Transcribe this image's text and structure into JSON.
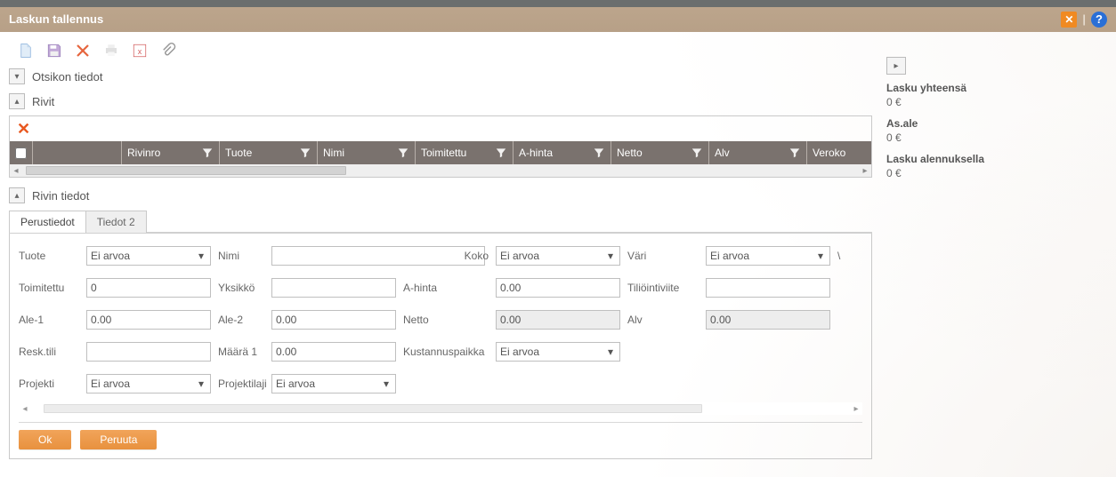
{
  "header": {
    "title": "Laskun tallennus"
  },
  "sections": {
    "otsikko": "Otsikon tiedot",
    "rivit": "Rivit",
    "rivin_tiedot": "Rivin tiedot"
  },
  "grid": {
    "columns": [
      "Rivinro",
      "Tuote",
      "Nimi",
      "Toimitettu",
      "A-hinta",
      "Netto",
      "Alv",
      "Veroko"
    ]
  },
  "tabs": {
    "perustiedot": "Perustiedot",
    "tiedot2": "Tiedot 2"
  },
  "form": {
    "labels": {
      "tuote": "Tuote",
      "nimi": "Nimi",
      "koko": "Koko",
      "vari": "Väri",
      "toimitettu": "Toimitettu",
      "yksikko": "Yksikkö",
      "ahinta": "A-hinta",
      "tilioiviite": "Tiliöintiviite",
      "ale1": "Ale-1",
      "ale2": "Ale-2",
      "netto": "Netto",
      "alv": "Alv",
      "resktili": "Resk.tili",
      "maara1": "Määrä 1",
      "kustannuspaikka": "Kustannuspaikka",
      "projekti": "Projekti",
      "projektilaji": "Projektilaji"
    },
    "values": {
      "tuote": "Ei arvoa",
      "nimi": "",
      "koko": "Ei arvoa",
      "vari": "Ei arvoa",
      "toimitettu": "0",
      "yksikko": "",
      "ahinta": "0.00",
      "tilioiviite": "",
      "ale1": "0.00",
      "ale2": "0.00",
      "netto": "0.00",
      "alv": "0.00",
      "resktili": "",
      "maara1": "0.00",
      "kustannuspaikka": "Ei arvoa",
      "projekti": "Ei arvoa",
      "projektilaji": "Ei arvoa"
    },
    "extra_marker": "\\"
  },
  "buttons": {
    "ok": "Ok",
    "cancel": "Peruuta"
  },
  "summary": {
    "total_label": "Lasku yhteensä",
    "total_value": "0 €",
    "asale_label": "As.ale",
    "asale_value": "0 €",
    "disc_label": "Lasku alennuksella",
    "disc_value": "0 €"
  }
}
